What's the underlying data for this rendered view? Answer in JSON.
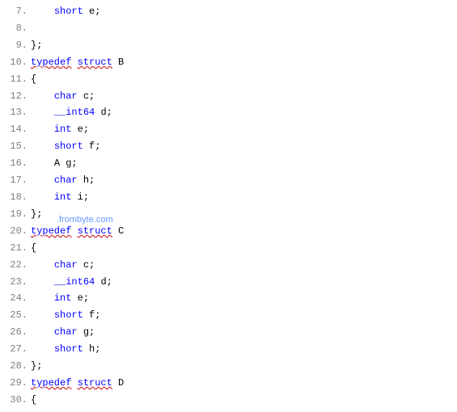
{
  "watermark": ".frombyte.com",
  "lines": [
    {
      "num": "7.",
      "indent": "    ",
      "tokens": [
        {
          "t": "short",
          "c": "kw"
        },
        {
          "t": " "
        },
        {
          "t": "e",
          "c": "ident"
        },
        {
          "t": ";",
          "c": "punct"
        }
      ]
    },
    {
      "num": "8.",
      "indent": "",
      "tokens": []
    },
    {
      "num": "9.",
      "indent": "",
      "tokens": [
        {
          "t": "};",
          "c": "punct"
        }
      ]
    },
    {
      "num": "10.",
      "indent": "",
      "tokens": [
        {
          "t": "typedef",
          "c": "kw underline"
        },
        {
          "t": " "
        },
        {
          "t": "struct",
          "c": "kw underline"
        },
        {
          "t": " "
        },
        {
          "t": "B",
          "c": "struct-name"
        }
      ]
    },
    {
      "num": "11.",
      "indent": "",
      "tokens": [
        {
          "t": "{",
          "c": "punct"
        }
      ]
    },
    {
      "num": "12.",
      "indent": "    ",
      "tokens": [
        {
          "t": "char",
          "c": "kw"
        },
        {
          "t": " "
        },
        {
          "t": "c",
          "c": "ident"
        },
        {
          "t": ";",
          "c": "punct"
        }
      ]
    },
    {
      "num": "13.",
      "indent": "    ",
      "tokens": [
        {
          "t": "__int64",
          "c": "kw"
        },
        {
          "t": " "
        },
        {
          "t": "d",
          "c": "ident"
        },
        {
          "t": ";",
          "c": "punct"
        }
      ]
    },
    {
      "num": "14.",
      "indent": "    ",
      "tokens": [
        {
          "t": "int",
          "c": "kw"
        },
        {
          "t": " "
        },
        {
          "t": "e",
          "c": "ident"
        },
        {
          "t": ";",
          "c": "punct"
        }
      ]
    },
    {
      "num": "15.",
      "indent": "    ",
      "tokens": [
        {
          "t": "short",
          "c": "kw"
        },
        {
          "t": " "
        },
        {
          "t": "f",
          "c": "ident"
        },
        {
          "t": ";",
          "c": "punct"
        }
      ]
    },
    {
      "num": "16.",
      "indent": "    ",
      "tokens": [
        {
          "t": "A",
          "c": "ident"
        },
        {
          "t": " "
        },
        {
          "t": "g",
          "c": "ident"
        },
        {
          "t": ";",
          "c": "punct"
        }
      ]
    },
    {
      "num": "17.",
      "indent": "    ",
      "tokens": [
        {
          "t": "char",
          "c": "kw"
        },
        {
          "t": " "
        },
        {
          "t": "h",
          "c": "ident"
        },
        {
          "t": ";",
          "c": "punct"
        }
      ]
    },
    {
      "num": "18.",
      "indent": "    ",
      "tokens": [
        {
          "t": "int",
          "c": "kw"
        },
        {
          "t": " "
        },
        {
          "t": "i",
          "c": "ident"
        },
        {
          "t": ";",
          "c": "punct"
        }
      ]
    },
    {
      "num": "19.",
      "indent": "",
      "tokens": [
        {
          "t": "};",
          "c": "punct"
        }
      ]
    },
    {
      "num": "20.",
      "indent": "",
      "tokens": [
        {
          "t": "typedef",
          "c": "kw underline"
        },
        {
          "t": " "
        },
        {
          "t": "struct",
          "c": "kw underline"
        },
        {
          "t": " "
        },
        {
          "t": "C",
          "c": "struct-name"
        }
      ]
    },
    {
      "num": "21.",
      "indent": "",
      "tokens": [
        {
          "t": "{",
          "c": "punct"
        }
      ]
    },
    {
      "num": "22.",
      "indent": "    ",
      "tokens": [
        {
          "t": "char",
          "c": "kw"
        },
        {
          "t": " "
        },
        {
          "t": "c",
          "c": "ident"
        },
        {
          "t": ";",
          "c": "punct"
        }
      ]
    },
    {
      "num": "23.",
      "indent": "    ",
      "tokens": [
        {
          "t": "__int64",
          "c": "kw"
        },
        {
          "t": " "
        },
        {
          "t": "d",
          "c": "ident"
        },
        {
          "t": ";",
          "c": "punct"
        }
      ]
    },
    {
      "num": "24.",
      "indent": "    ",
      "tokens": [
        {
          "t": "int",
          "c": "kw"
        },
        {
          "t": " "
        },
        {
          "t": "e",
          "c": "ident"
        },
        {
          "t": ";",
          "c": "punct"
        }
      ]
    },
    {
      "num": "25.",
      "indent": "    ",
      "tokens": [
        {
          "t": "short",
          "c": "kw"
        },
        {
          "t": " "
        },
        {
          "t": "f",
          "c": "ident"
        },
        {
          "t": ";",
          "c": "punct"
        }
      ]
    },
    {
      "num": "26.",
      "indent": "    ",
      "tokens": [
        {
          "t": "char",
          "c": "kw"
        },
        {
          "t": " "
        },
        {
          "t": "g",
          "c": "ident"
        },
        {
          "t": ";",
          "c": "punct"
        }
      ]
    },
    {
      "num": "27.",
      "indent": "    ",
      "tokens": [
        {
          "t": "short",
          "c": "kw"
        },
        {
          "t": " "
        },
        {
          "t": "h",
          "c": "ident"
        },
        {
          "t": ";",
          "c": "punct"
        }
      ]
    },
    {
      "num": "28.",
      "indent": "",
      "tokens": [
        {
          "t": "};",
          "c": "punct"
        }
      ]
    },
    {
      "num": "29.",
      "indent": "",
      "tokens": [
        {
          "t": "typedef",
          "c": "kw underline"
        },
        {
          "t": " "
        },
        {
          "t": "struct",
          "c": "kw underline"
        },
        {
          "t": " "
        },
        {
          "t": "D",
          "c": "struct-name"
        }
      ]
    },
    {
      "num": "30.",
      "indent": "",
      "tokens": [
        {
          "t": "{",
          "c": "punct"
        }
      ]
    }
  ]
}
